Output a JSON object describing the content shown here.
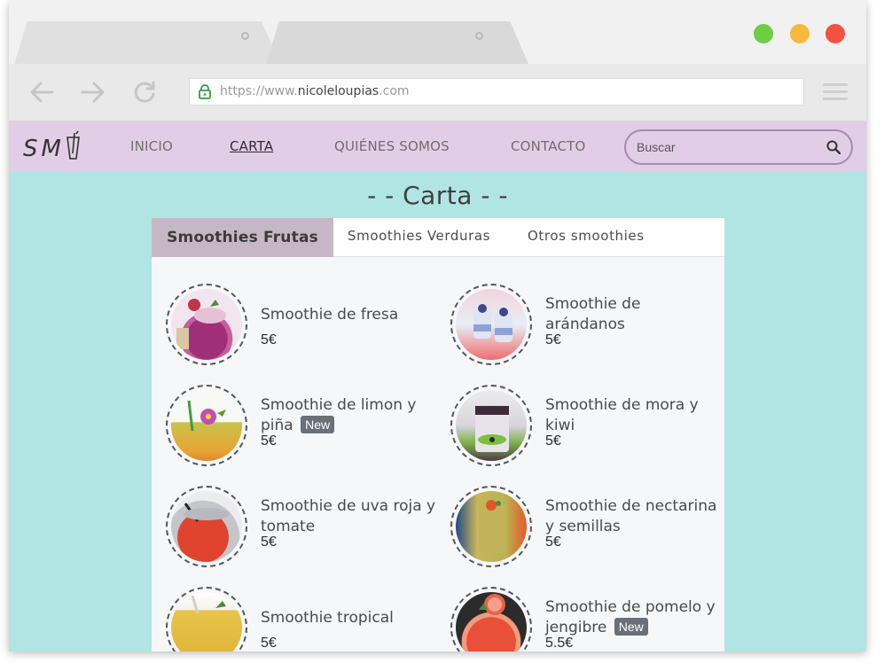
{
  "browser": {
    "url_prefix": "https://www.",
    "url_host": "nicoleloupias",
    "url_suffix": ".com",
    "window_colors": {
      "close": "#f2523f",
      "minimize": "#f6b93b",
      "maximize": "#6fcd41"
    }
  },
  "site": {
    "logo_text": "SM",
    "nav": [
      {
        "label": "INICIO"
      },
      {
        "label": "CARTA"
      },
      {
        "label": "QUIÉNES SOMOS"
      },
      {
        "label": "CONTACTO"
      }
    ],
    "search_placeholder": "Buscar",
    "page_title": "- - Carta - -",
    "tabs": [
      {
        "label": "Smoothies Frutas"
      },
      {
        "label": "Smoothies Verduras"
      },
      {
        "label": "Otros smoothies"
      }
    ],
    "items": [
      {
        "name": "Smoothie de fresa",
        "badge": "",
        "price": "5€"
      },
      {
        "name": "Smoothie de arándanos",
        "badge": "",
        "price": "5€"
      },
      {
        "name": "Smoothie de limon y piña",
        "badge": "New",
        "price": "5€"
      },
      {
        "name": "Smoothie de mora y kiwi",
        "badge": "",
        "price": "5€"
      },
      {
        "name": "Smoothie de uva roja y tomate",
        "badge": "",
        "price": "5€"
      },
      {
        "name": "Smoothie de nectarina y semillas",
        "badge": "",
        "price": "5€"
      },
      {
        "name": "Smoothie tropical",
        "badge": "",
        "price": "5€"
      },
      {
        "name": "Smoothie de pomelo y jengibre",
        "badge": "New",
        "price": "5.5€"
      }
    ]
  },
  "colors": {
    "nav_bg": "#e2cde6",
    "page_bg": "#b0e5e4",
    "active_tab_bg": "#c6b7c7",
    "badge_bg": "#6a7078"
  }
}
